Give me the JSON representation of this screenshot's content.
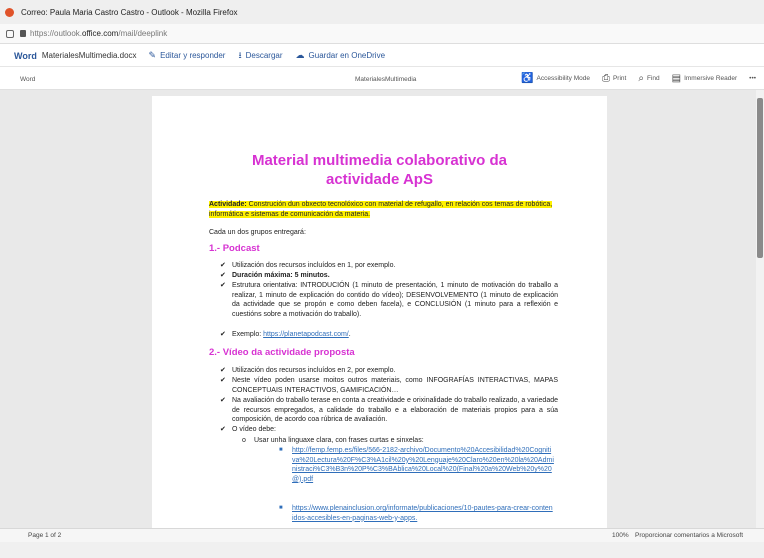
{
  "window": {
    "title": "Correo: Paula Maria Castro Castro - Outlook - Mozilla Firefox"
  },
  "address": {
    "prefix": "https://outlook.",
    "domain": "office.com",
    "path": "/mail/deeplink"
  },
  "word_bar": {
    "brand": "Word",
    "doc_name": "MaterialesMultimedia.docx",
    "actions": [
      {
        "icon": "edit-icon",
        "label": "Editar y responder"
      },
      {
        "icon": "download-icon",
        "label": "Descargar"
      },
      {
        "icon": "onedrive-icon",
        "label": "Guardar en OneDrive"
      }
    ]
  },
  "doc_bar": {
    "app": "Word",
    "center_title": "MaterialesMultimedia",
    "tools": [
      {
        "icon": "accessibility-icon",
        "label": "Accessibility Mode"
      },
      {
        "icon": "print-icon",
        "label": "Print"
      },
      {
        "icon": "search-icon",
        "label": "Find"
      },
      {
        "icon": "immersive-reader-icon",
        "label": "Immersive Reader"
      }
    ],
    "more": "•••"
  },
  "document": {
    "title_line1": "Material multimedia colaborativo da",
    "title_line2": "actividade ApS",
    "activity_label": "Actividade:",
    "activity_text": " Construción dun obxecto tecnolóxico con material de refugallo, en relación cos temas de robótica, informática e sistemas de comunicación da materia.",
    "intro": "Cada un dos grupos entregará:",
    "section1": {
      "heading": "1.- Podcast",
      "bullets": [
        "Utilización dos recursos incluídos en 1, por exemplo.",
        "Estrutura orientativa: INTRODUCIÓN (1 minuto de presentación, 1 minuto de motivación do traballo a realizar, 1 minuto de explicación do contido do vídeo); DESENVOLVEMENTO (1 minuto de explicación da actividade que se propón e como deben facela), e CONCLUSIÓN (1 minuto para a reflexión e cuestións sobre a motivación do traballo)."
      ],
      "duration_label": "Duración máxima:",
      "duration_value": " 5 minutos.",
      "example_label": "Exemplo: ",
      "example_link": "https://planetapodcast.com/",
      "example_tail": "."
    },
    "section2": {
      "heading": "2.- Vídeo da actividade proposta",
      "bullets": [
        "Utilización dos recursos incluídos en 2, por exemplo.",
        "Neste vídeo poden usarse moitos outros materiais, como INFOGRAFÍAS INTERACTIVAS, MAPAS CONCEPTUAIS INTERACTIVOS, GAMIFICACIÓN…",
        "Na avaliación do traballo terase en conta a creatividade e orixinalidade do traballo realizado, a variedade de recursos empregados, a calidade do traballo e a elaboración de materiais propios para a súa composición, de acordo coa rúbrica de avaliación.",
        "O vídeo debe:"
      ],
      "sub_bullet": "Usar unha linguaxe clara, con frases curtas e sinxelas:",
      "links": [
        "http://femp.femp.es/files/566-2182-archivo/Documento%20Accesibilidad%20Cognitiva%20Lectura%20F%C3%A1cil%20y%20Lenguaje%20Claro%20en%20la%20Administraci%C3%B3n%20P%C3%BAblica%20Local%20(Final%20a%20Web%20y%20@).pdf",
        "https://www.plenainclusion.org/informate/publicaciones/10-pautes-para-crear-contenidos-accesibles-en-paginas-web-y-apps."
      ]
    }
  },
  "status": {
    "page": "Page 1 of 2",
    "zoom": "100%",
    "feedback": "Proporcionar comentarios a Microsoft"
  }
}
